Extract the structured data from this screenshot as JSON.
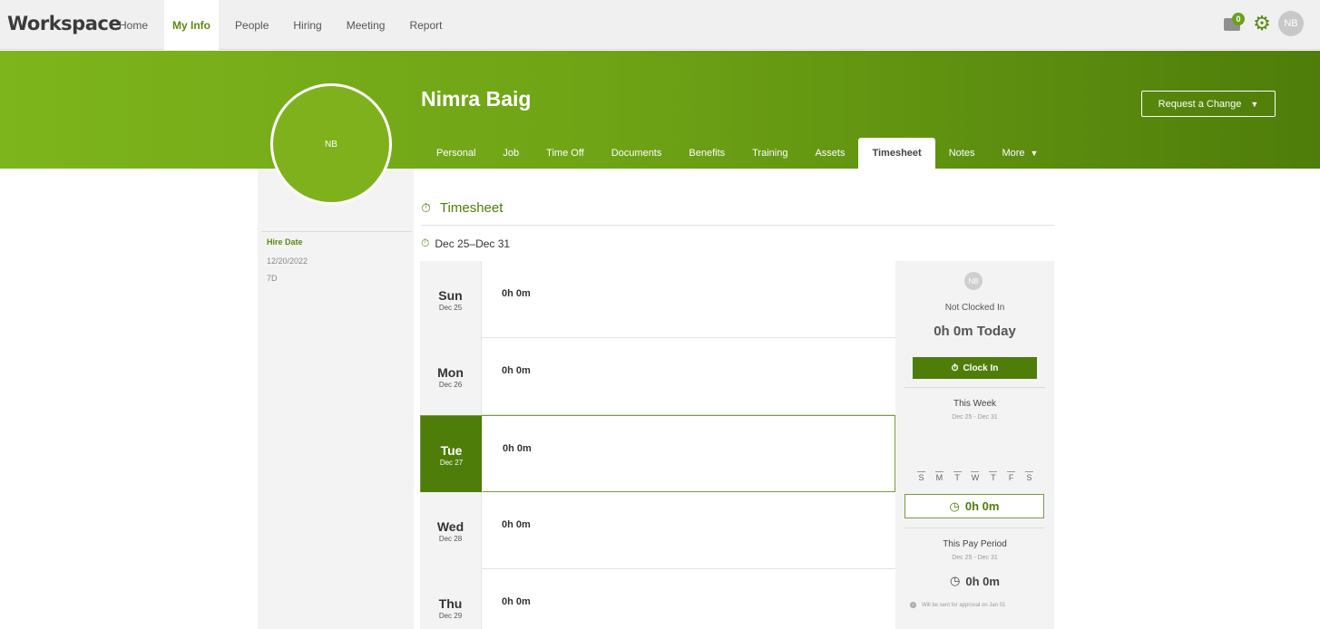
{
  "app": {
    "logo": "Workspace",
    "nav": [
      "Home",
      "My Info",
      "People",
      "Hiring",
      "Meeting",
      "Report"
    ],
    "active_nav": "My Info",
    "inbox_count": "0",
    "user_initials": "NB",
    "accent": "#5a8a10"
  },
  "profile": {
    "initials": "NB",
    "name": "Nimra Baig",
    "request_button": "Request a Change",
    "tabs": [
      "Personal",
      "Job",
      "Time Off",
      "Documents",
      "Benefits",
      "Training",
      "Assets",
      "Timesheet",
      "Notes",
      "More"
    ],
    "active_tab": "Timesheet",
    "hire_label": "Hire Date",
    "hire_date": "12/20/2022",
    "tenure": "7D"
  },
  "timesheet": {
    "title": "Timesheet",
    "week_range": "Dec 25–Dec 31",
    "days": [
      {
        "name": "Sun",
        "date": "Dec 25",
        "hours": "0h 0m"
      },
      {
        "name": "Mon",
        "date": "Dec 26",
        "hours": "0h 0m"
      },
      {
        "name": "Tue",
        "date": "Dec 27",
        "hours": "0h 0m"
      },
      {
        "name": "Wed",
        "date": "Dec 28",
        "hours": "0h 0m"
      },
      {
        "name": "Thu",
        "date": "Dec 29",
        "hours": "0h 0m"
      }
    ],
    "active_day": "Tue",
    "panel": {
      "initials": "NB",
      "status": "Not Clocked In",
      "today": "0h 0m Today",
      "clock_in_label": "Clock In",
      "week_title": "This Week",
      "week_range": "Dec 25 - Dec 31",
      "weekdays": [
        "S",
        "M",
        "T",
        "W",
        "T",
        "F",
        "S"
      ],
      "week_total": "0h 0m",
      "pay_period_title": "This Pay Period",
      "pay_period_range": "Dec 25 - Dec 31",
      "pay_period_total": "0h 0m",
      "approval_note": "Will be sent for approval on Jan 01"
    }
  }
}
